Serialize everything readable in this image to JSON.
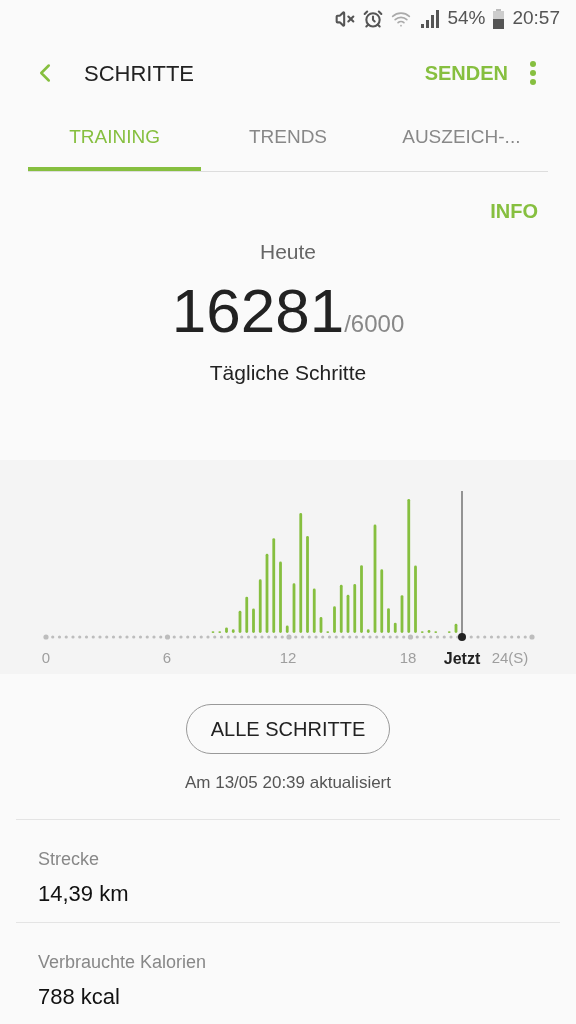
{
  "status_bar": {
    "battery": "54%",
    "time": "20:57"
  },
  "header": {
    "title": "SCHRITTE",
    "action": "SENDEN"
  },
  "tabs": [
    {
      "label": "TRAINING",
      "selected": true
    },
    {
      "label": "TRENDS",
      "selected": false
    },
    {
      "label": "AUSZEICH-...",
      "selected": false
    }
  ],
  "info": "INFO",
  "summary": {
    "label": "Heute",
    "steps": "16281",
    "goal": "/6000",
    "caption": "Tägliche Schritte"
  },
  "timeline": {
    "axis_labels": [
      {
        "text": "0",
        "kind": "tick"
      },
      {
        "text": "6",
        "kind": "tick"
      },
      {
        "text": "12",
        "kind": "tick"
      },
      {
        "text": "18",
        "kind": "tick"
      },
      {
        "text": "Jetzt",
        "kind": "now"
      },
      {
        "text": "24(S)",
        "kind": "tick"
      }
    ]
  },
  "all_button": "ALLE SCHRITTE",
  "updated": "Am 13/05 20:39 aktualisiert",
  "stats": [
    {
      "label": "Strecke",
      "value": "14,39 km"
    },
    {
      "label": "Verbrauchte Kalorien",
      "value": "788 kcal"
    }
  ]
}
